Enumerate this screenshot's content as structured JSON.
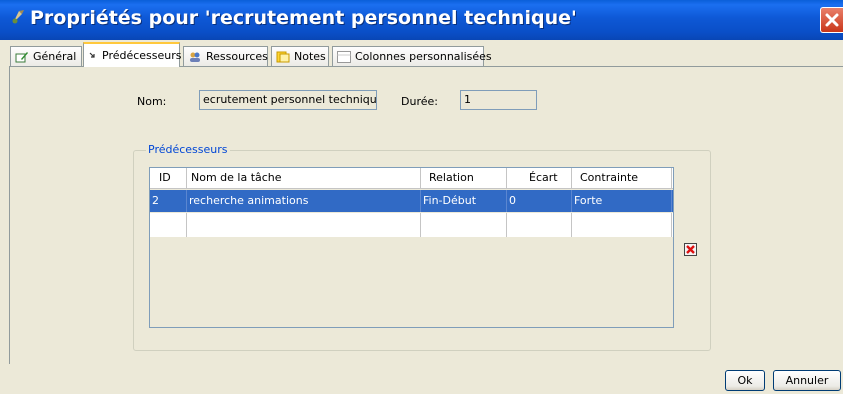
{
  "window": {
    "title": "Propriétés pour 'recrutement personnel technique'"
  },
  "tabs": [
    {
      "label": "Général",
      "icon": "edit-icon"
    },
    {
      "label": "Prédécesseurs",
      "icon": "predecessor-arrow-icon",
      "active": true
    },
    {
      "label": "Ressources",
      "icon": "resources-icon"
    },
    {
      "label": "Notes",
      "icon": "notes-icon"
    },
    {
      "label": "Colonnes personnalisées",
      "icon": "columns-icon"
    }
  ],
  "form": {
    "name_label": "Nom:",
    "name_value": "ecrutement personnel technique",
    "duration_label": "Durée:",
    "duration_value": "1"
  },
  "predecessors": {
    "group_title": "Prédécesseurs",
    "columns": [
      "ID",
      "Nom de la tâche",
      "Relation",
      "Écart",
      "Contrainte"
    ],
    "rows": [
      {
        "id": "2",
        "task": "recherche animations",
        "relation": "Fin-Début",
        "gap": "0",
        "constraint": "Forte",
        "selected": true
      }
    ]
  },
  "buttons": {
    "ok": "Ok",
    "cancel": "Annuler"
  },
  "colors": {
    "titlebar": "#0a4fc8",
    "selection": "#316ac5",
    "group_title": "#0046d5"
  }
}
